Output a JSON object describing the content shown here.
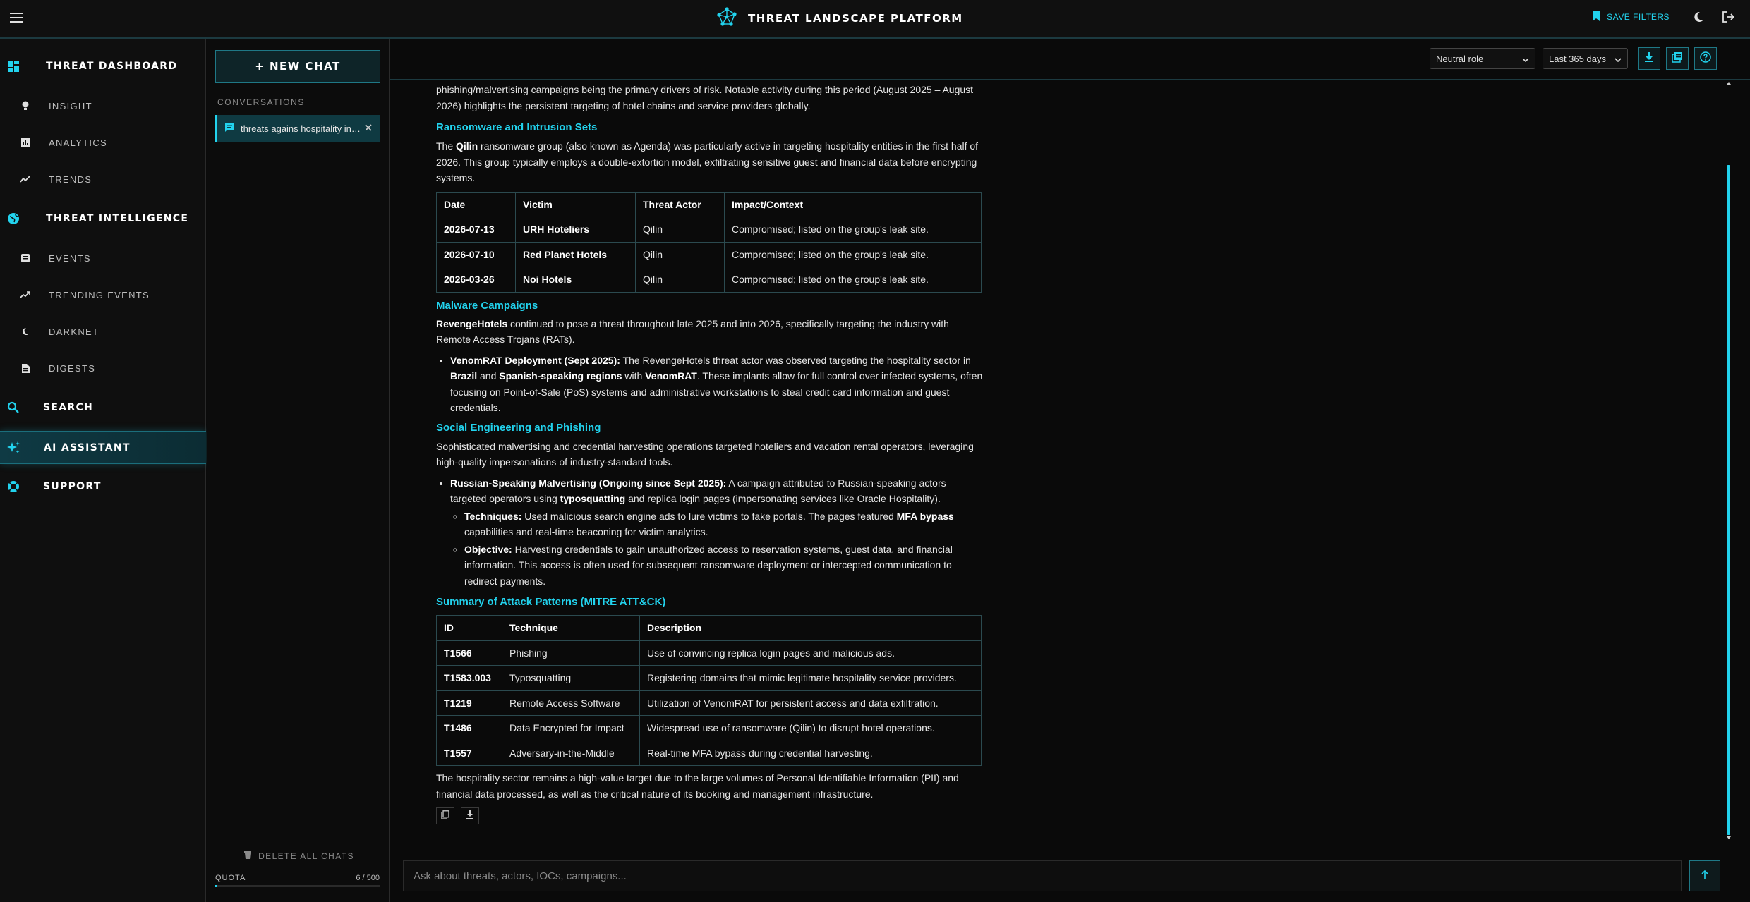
{
  "app": {
    "title": "THREAT LANDSCAPE PLATFORM"
  },
  "header": {
    "save_filters": "SAVE FILTERS"
  },
  "nav": {
    "threat_dashboard": "THREAT DASHBOARD",
    "insight": "INSIGHT",
    "analytics": "ANALYTICS",
    "trends": "TRENDS",
    "threat_intelligence": "THREAT INTELLIGENCE",
    "events": "EVENTS",
    "trending_events": "TRENDING EVENTS",
    "darknet": "DARKNET",
    "digests": "DIGESTS",
    "search": "SEARCH",
    "ai_assistant": "AI ASSISTANT",
    "support": "SUPPORT"
  },
  "chats": {
    "new_chat": "+ NEW CHAT",
    "heading": "CONVERSATIONS",
    "items": [
      {
        "title": "threats agains hospitality industry"
      }
    ],
    "delete_all": "DELETE ALL CHATS",
    "quota_label": "QUOTA",
    "quota_used": "6 / 500",
    "quota_fraction": 0.012
  },
  "toolbar": {
    "role": "Neutral role",
    "period": "Last 365 days"
  },
  "message": {
    "intro": "phishing/malvertising campaigns being the primary drivers of risk. Notable activity during this period (August 2025 – August 2026) highlights the persistent targeting of hotel chains and service providers globally.",
    "ransomware": {
      "heading": "Ransomware and Intrusion Sets",
      "p_pre": "The ",
      "p_bold": "Qilin",
      "p_post": " ransomware group (also known as Agenda) was particularly active in targeting hospitality entities in the first half of 2026. This group typically employs a double-extortion model, exfiltrating sensitive guest and financial data before encrypting systems.",
      "table_headers": [
        "Date",
        "Victim",
        "Threat Actor",
        "Impact/Context"
      ],
      "rows": [
        [
          "2026-07-13",
          "URH Hoteliers",
          "Qilin",
          "Compromised; listed on the group's leak site."
        ],
        [
          "2026-07-10",
          "Red Planet Hotels",
          "Qilin",
          "Compromised; listed on the group's leak site."
        ],
        [
          "2026-03-26",
          "Noi Hotels",
          "Qilin",
          "Compromised; listed on the group's leak site."
        ]
      ]
    },
    "malware": {
      "heading": "Malware Campaigns",
      "p_bold": "RevengeHotels",
      "p_post": " continued to pose a threat throughout late 2025 and into 2026, specifically targeting the industry with Remote Access Trojans (RATs).",
      "b1_bold": "VenomRAT Deployment (Sept 2025):",
      "b1_t1": " The RevengeHotels threat actor was observed targeting the hospitality sector in ",
      "b1_b2": "Brazil",
      "b1_t2": " and ",
      "b1_b3": "Spanish-speaking regions",
      "b1_t3": " with ",
      "b1_b4": "VenomRAT",
      "b1_t4": ". These implants allow for full control over infected systems, often focusing on Point-of-Sale (PoS) systems and administrative workstations to steal credit card information and guest credentials."
    },
    "social": {
      "heading": "Social Engineering and Phishing",
      "p": "Sophisticated malvertising and credential harvesting operations targeted hoteliers and vacation rental operators, leveraging high-quality impersonations of industry-standard tools.",
      "b1_bold": "Russian-Speaking Malvertising (Ongoing since Sept 2025):",
      "b1_t1": " A campaign attributed to Russian-speaking actors targeted operators using ",
      "b1_b2": "typosquatting",
      "b1_t2": " and replica login pages (impersonating services like Oracle Hospitality).",
      "s1_bold": "Techniques:",
      "s1_t1": " Used malicious search engine ads to lure victims to fake portals. The pages featured ",
      "s1_b2": "MFA bypass",
      "s1_t2": " capabilities and real-time beaconing for victim analytics.",
      "s2_bold": "Objective:",
      "s2_t1": " Harvesting credentials to gain unauthorized access to reservation systems, guest data, and financial information. This access is often used for subsequent ransomware deployment or intercepted communication to redirect payments."
    },
    "mitre": {
      "heading": "Summary of Attack Patterns (MITRE ATT&CK)",
      "table_headers": [
        "ID",
        "Technique",
        "Description"
      ],
      "rows": [
        [
          "T1566",
          "Phishing",
          "Use of convincing replica login pages and malicious ads."
        ],
        [
          "T1583.003",
          "Typosquatting",
          "Registering domains that mimic legitimate hospitality service providers."
        ],
        [
          "T1219",
          "Remote Access Software",
          "Utilization of VenomRAT for persistent access and data exfiltration."
        ],
        [
          "T1486",
          "Data Encrypted for Impact",
          "Widespread use of ransomware (Qilin) to disrupt hotel operations."
        ],
        [
          "T1557",
          "Adversary-in-the-Middle",
          "Real-time MFA bypass during credential harvesting."
        ]
      ]
    },
    "conclusion": "The hospitality sector remains a high-value target due to the large volumes of Personal Identifiable Information (PII) and financial data processed, as well as the critical nature of its booking and management infrastructure."
  },
  "composer": {
    "placeholder": "Ask about threats, actors, IOCs, campaigns..."
  },
  "colors": {
    "accent": "#22d3ee",
    "background": "#0b0b0b",
    "active_nav": "#0f3a44"
  },
  "icons": [
    "menu-icon",
    "network-logo-icon",
    "bookmark-icon",
    "moon-icon",
    "logout-icon",
    "dashboard-icon",
    "lightbulb-icon",
    "bar-chart-icon",
    "trend-line-icon",
    "globe-icon",
    "list-icon",
    "trending-icon",
    "darknet-icon",
    "document-icon",
    "search-icon",
    "sparkle-icon",
    "support-icon",
    "chat-bubble-icon",
    "close-icon",
    "trash-icon",
    "download-icon",
    "export-icon",
    "help-icon",
    "copy-icon",
    "send-arrow-icon"
  ]
}
